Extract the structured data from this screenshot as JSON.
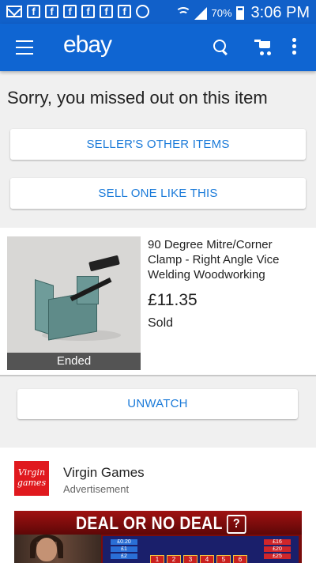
{
  "status_bar": {
    "battery": "70%",
    "time": "3:06 PM"
  },
  "app_bar": {
    "logo": "ebay"
  },
  "main": {
    "headline": "Sorry, you missed out on this item",
    "seller_items_button": "SELLER'S OTHER ITEMS",
    "sell_like_button": "SELL ONE LIKE THIS"
  },
  "item": {
    "image_overlay": "Ended",
    "title": "90 Degree Mitre/Corner Clamp - Right Angle Vice Welding Woodworking",
    "price": "£11.35",
    "status": "Sold"
  },
  "unwatch_button": "UNWATCH",
  "ad": {
    "logo_text": "Virgin games",
    "advertiser": "Virgin Games",
    "label": "Advertisement",
    "banner_title": "DEAL OR NO DEAL",
    "banner_badge": "?",
    "board_left": [
      "£0.20",
      "£1",
      "£2"
    ],
    "board_right": [
      "£16",
      "£20",
      "£25"
    ],
    "board_boxes": [
      "1",
      "2",
      "3",
      "4",
      "5",
      "6"
    ]
  },
  "colors": {
    "app_bar": "#0f65d2",
    "status_bar": "#1160c9",
    "link_blue": "#1a7ad9",
    "ad_logo": "#e0191e"
  }
}
